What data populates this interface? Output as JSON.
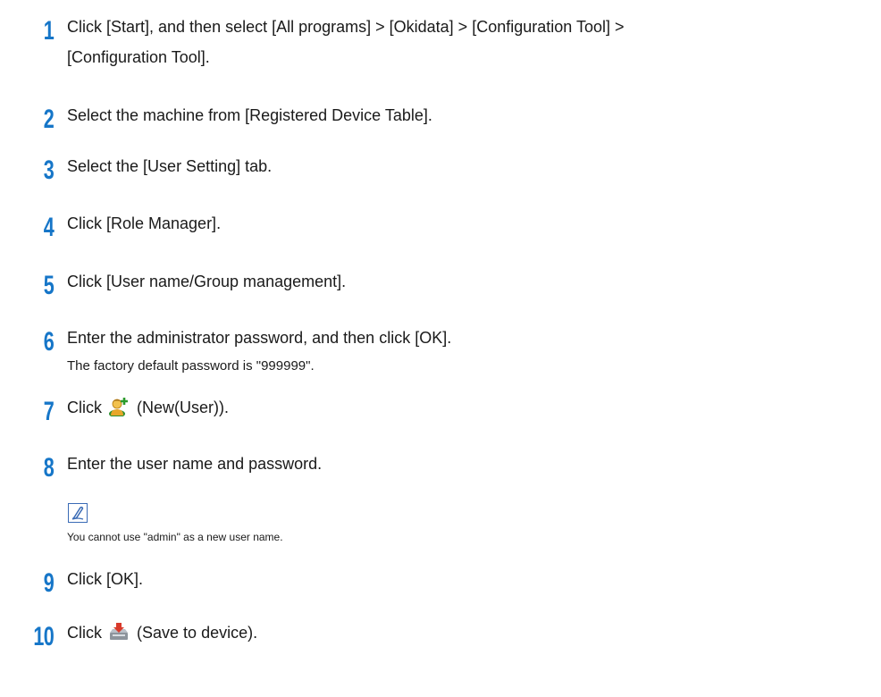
{
  "steps": [
    {
      "num": "1",
      "line1": "Click [Start], and then select [All programs] > [Okidata] > [Configuration Tool] >",
      "line2": "[Configuration Tool]."
    },
    {
      "num": "2",
      "text": "Select the machine from [Registered Device Table]."
    },
    {
      "num": "3",
      "text": "Select the [User Setting] tab."
    },
    {
      "num": "4",
      "text": "Click [Role Manager]."
    },
    {
      "num": "5",
      "text": "Click [User name/Group management]."
    },
    {
      "num": "6",
      "text": "Enter the administrator password, and then click [OK].",
      "sub": "The factory default password is \"999999\"."
    },
    {
      "num": "7",
      "prefix": "Click",
      "icon": "new-user-icon",
      "suffix": "(New(User))."
    },
    {
      "num": "8",
      "text": "Enter the user name and password."
    },
    {
      "num": "9",
      "text": "Click [OK]."
    },
    {
      "num": "10",
      "prefix": "Click",
      "icon": "save-to-device-icon",
      "suffix": "(Save to device)."
    }
  ],
  "note": {
    "icon": "memo-pen-icon",
    "text": "You cannot use \"admin\" as a new user name."
  },
  "colors": {
    "step_number": "#1676c8",
    "note_icon_border": "#3a6bb5"
  }
}
